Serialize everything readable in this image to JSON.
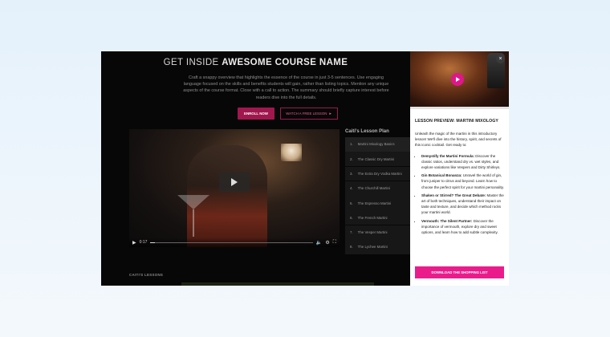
{
  "hero": {
    "title_light": "GET INSIDE ",
    "title_bold": "AWESOME COURSE NAME",
    "description": "Craft a snappy overview that highlights the essence of the course in just 3-5 sentences. Use engaging language focused on the skills and benefits students will gain, rather than listing topics. Mention any unique aspects of the course format. Close with a call to action. The summary should briefly capture interest before readers dive into the full details.",
    "enroll_label": "ENROLL NOW",
    "watch_label": "WATCH A FREE LESSON",
    "watch_icon": "play-circle-icon",
    "accent": "#a0174e"
  },
  "video": {
    "time": "0:17",
    "progress": 0.03
  },
  "lesson_plan": {
    "title": "Caiti's Lesson Plan",
    "items": [
      {
        "num": "1.",
        "label": "Martini Mixology Basics"
      },
      {
        "num": "2.",
        "label": "The Classic Dry Martini"
      },
      {
        "num": "3.",
        "label": "The Extra Dry Vodka Martini"
      },
      {
        "num": "4.",
        "label": "The Churchill Martini"
      },
      {
        "num": "5.",
        "label": "The Espresso Martini"
      },
      {
        "num": "6.",
        "label": "The French Martini"
      },
      {
        "num": "7.",
        "label": "The Vesper Martini"
      },
      {
        "num": "8.",
        "label": "The Lychee Martini"
      }
    ]
  },
  "lessons_label": "CAITI'S LESSONS",
  "panel": {
    "title": "LESSON PREVIEW: MARTINI MIXOLOGY",
    "intro": "Unleash the magic of the martini in this introductory lesson! We'll dive into the history, spirit, and secrets of this iconic cocktail. Get ready to:",
    "points": [
      {
        "bold": "Demystify the Martini Formula:",
        "text": " Discover the classic ratios, understand dry vs. wet styles, and explore variations like Vespers and Dirty Shirleys."
      },
      {
        "bold": "Gin Botanical Bonanza:",
        "text": " Unravel the world of gin, from juniper to citrus and beyond. Learn how to choose the perfect spirit for your martini personality."
      },
      {
        "bold": "Shaken or Stirred? The Great Debate:",
        "text": " Master the art of both techniques, understand their impact on taste and texture, and decide which method rocks your martini world."
      },
      {
        "bold": "Vermouth: The Silent Partner:",
        "text": " Discover the importance of vermouth, explore dry and sweet options, and learn how to add subtle complexity."
      }
    ],
    "download_label": "DOWNLOAD THE SHOPPING LIST",
    "accent": "#ea1c8c"
  }
}
